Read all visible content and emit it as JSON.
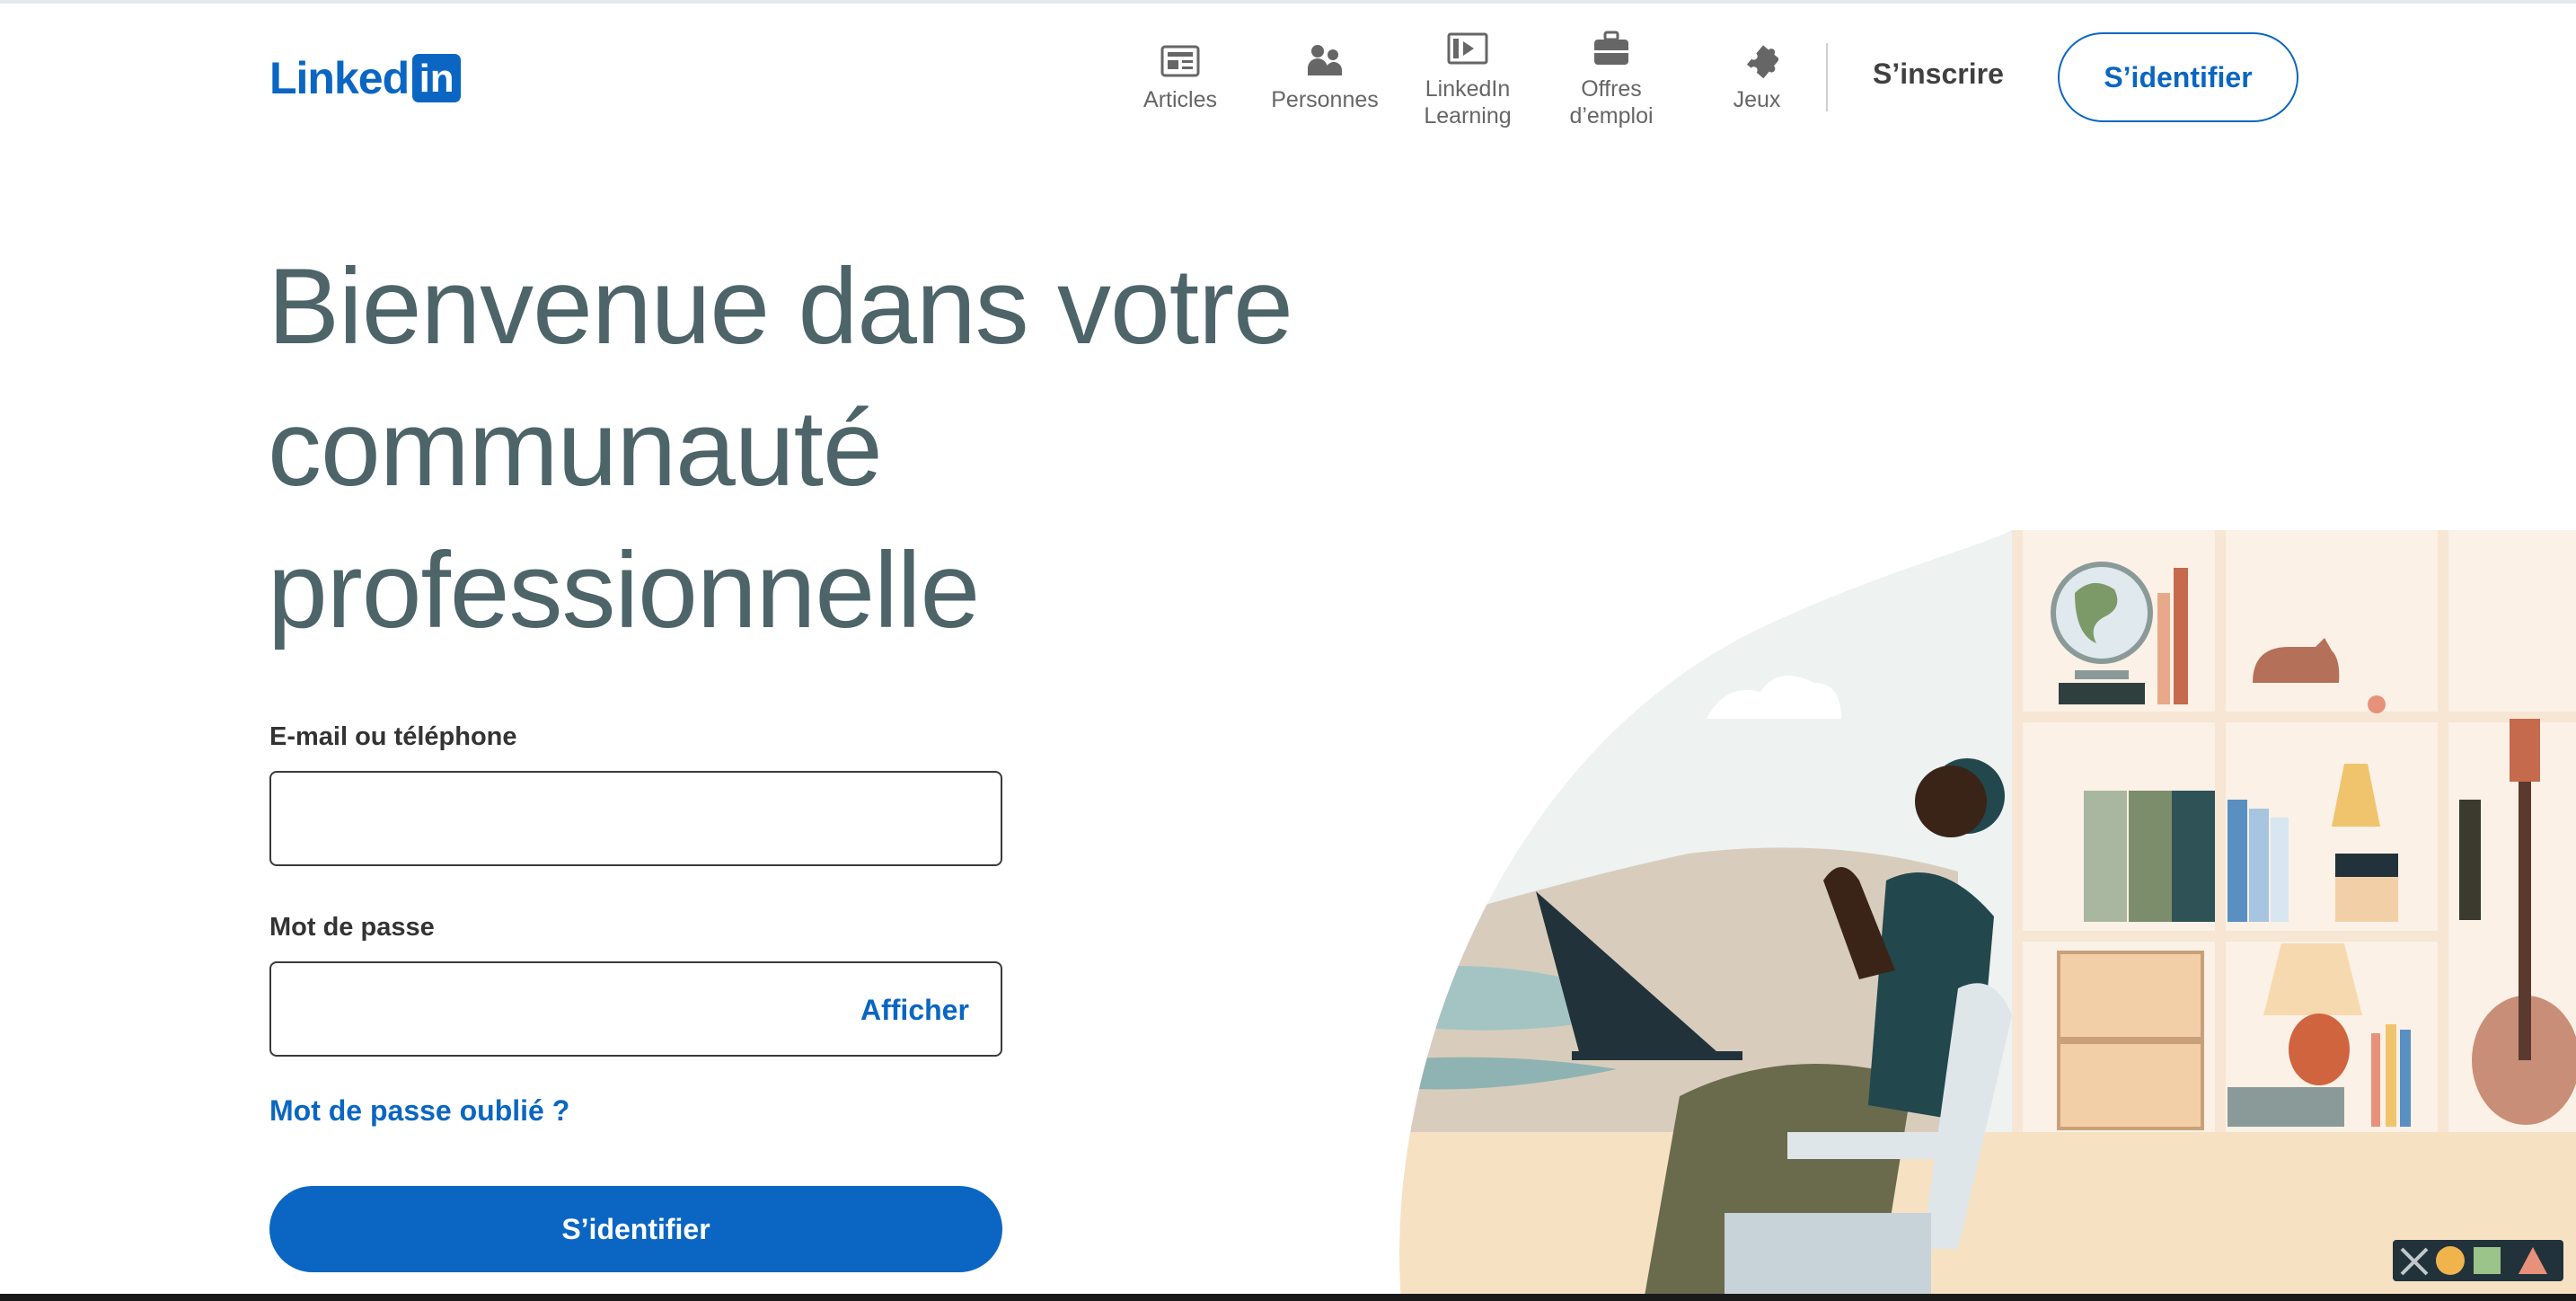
{
  "header": {
    "logo_text": "Linked",
    "logo_box_text": "in",
    "nav": [
      {
        "label1": "Articles",
        "label2": "",
        "icon": "articles-icon"
      },
      {
        "label1": "Personnes",
        "label2": "",
        "icon": "people-icon"
      },
      {
        "label1": "LinkedIn",
        "label2": "Learning",
        "icon": "learning-icon"
      },
      {
        "label1": "Offres",
        "label2": "d’emploi",
        "icon": "briefcase-icon"
      },
      {
        "label1": "Jeux",
        "label2": "",
        "icon": "puzzle-icon"
      }
    ],
    "join_label": "S’inscrire",
    "signin_label": "S’identifier"
  },
  "hero": {
    "line1": "Bienvenue dans votre",
    "line2": "communauté",
    "line3": "professionnelle"
  },
  "form": {
    "email_label": "E-mail ou téléphone",
    "email_value": "",
    "password_label": "Mot de passe",
    "password_value": "",
    "show_label": "Afficher",
    "forgot_label": "Mot de passe oublié ?",
    "submit_label": "S’identifier"
  },
  "colors": {
    "brand": "#0a66c2",
    "headline": "#4d6469"
  }
}
